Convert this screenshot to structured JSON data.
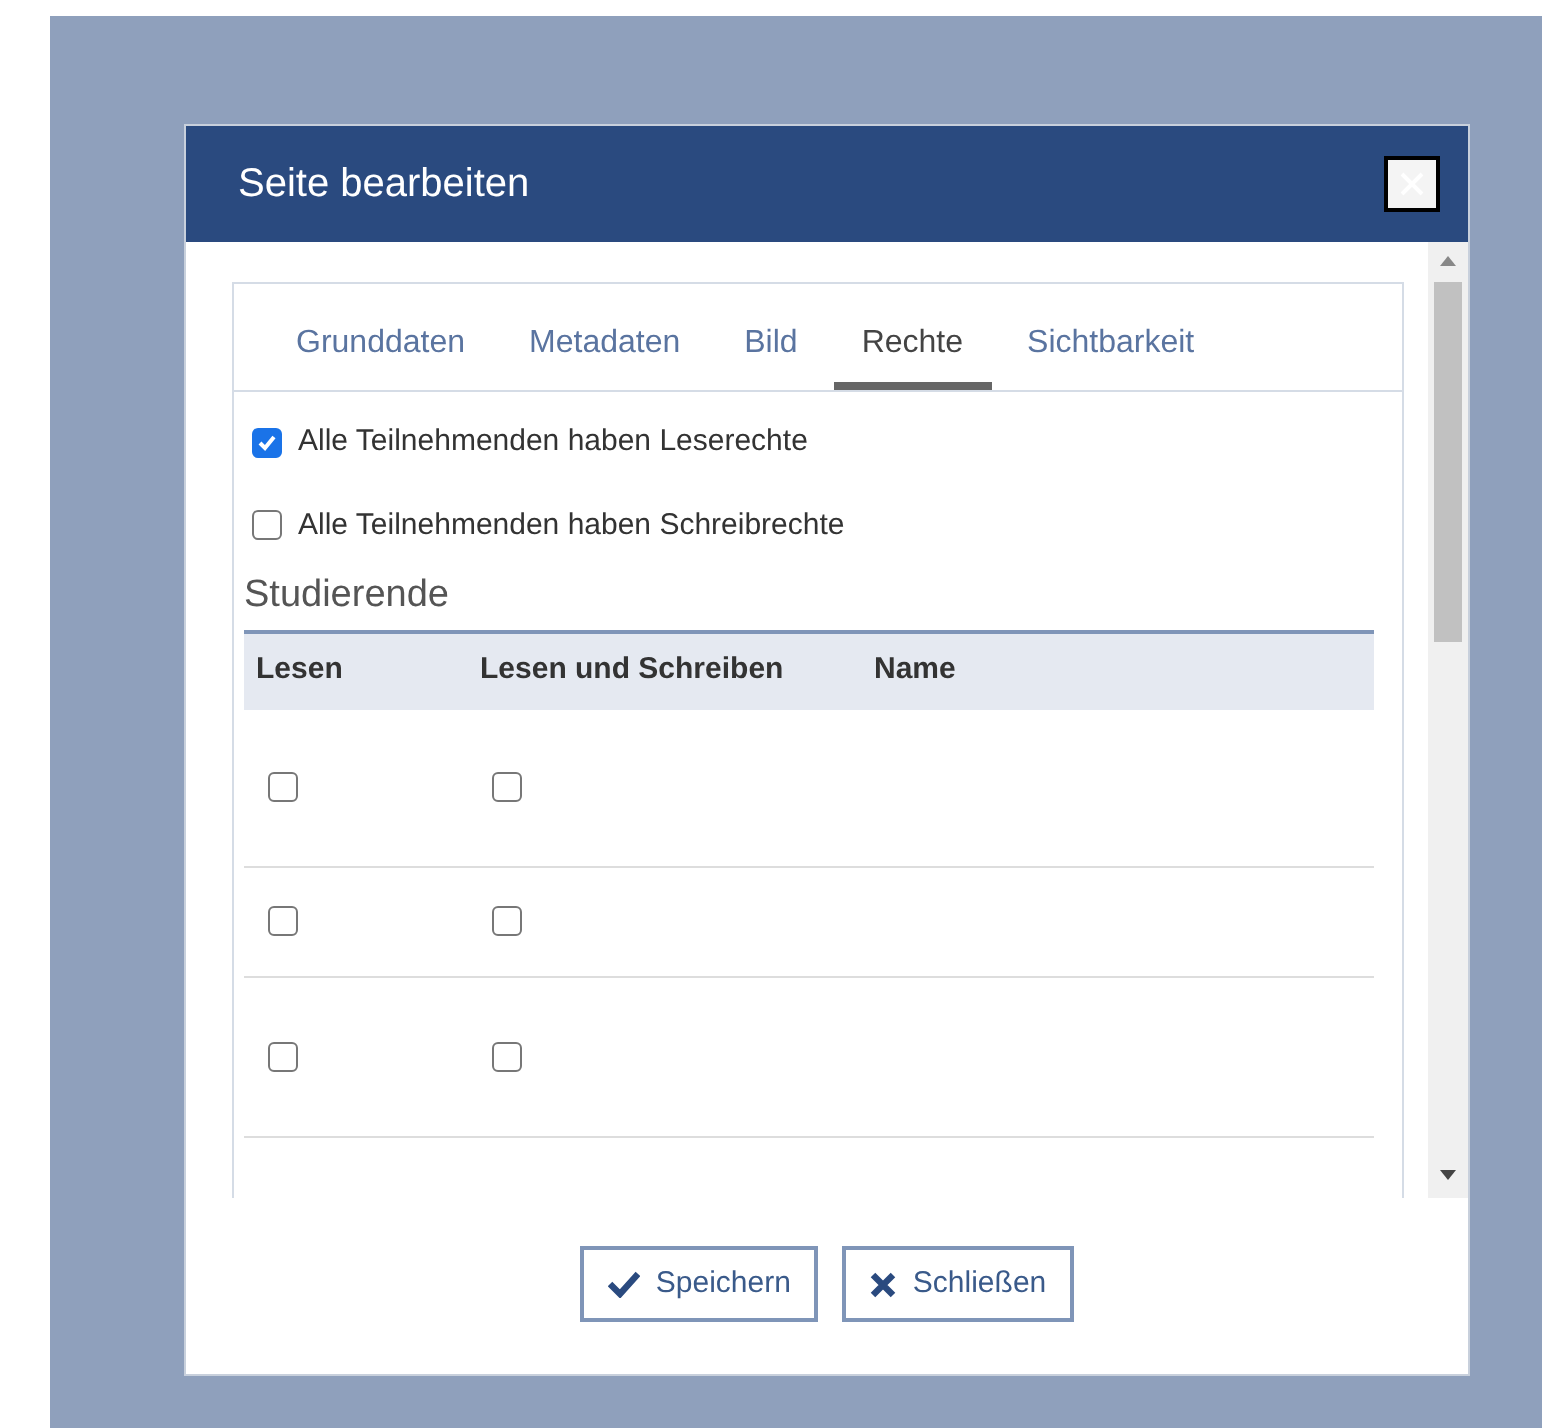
{
  "dialog": {
    "title": "Seite bearbeiten"
  },
  "tabs": [
    {
      "label": "Grunddaten",
      "selected": false
    },
    {
      "label": "Metadaten",
      "selected": false
    },
    {
      "label": "Bild",
      "selected": false
    },
    {
      "label": "Rechte",
      "selected": true
    },
    {
      "label": "Sichtbarkeit",
      "selected": false
    }
  ],
  "options": [
    {
      "label": "Alle Teilnehmenden haben Leserechte",
      "checked": true
    },
    {
      "label": "Alle Teilnehmenden haben Schreibrechte",
      "checked": false
    }
  ],
  "section_title": "Studierende",
  "table": {
    "columns": [
      "Lesen",
      "Lesen und Schreiben",
      "Name"
    ],
    "rows": [
      {
        "read": false,
        "write": false
      },
      {
        "read": false,
        "write": false
      },
      {
        "read": false,
        "write": false
      }
    ]
  },
  "buttons": [
    {
      "kind": "save",
      "label": "Speichern"
    },
    {
      "kind": "close",
      "label": "Schließen"
    }
  ]
}
